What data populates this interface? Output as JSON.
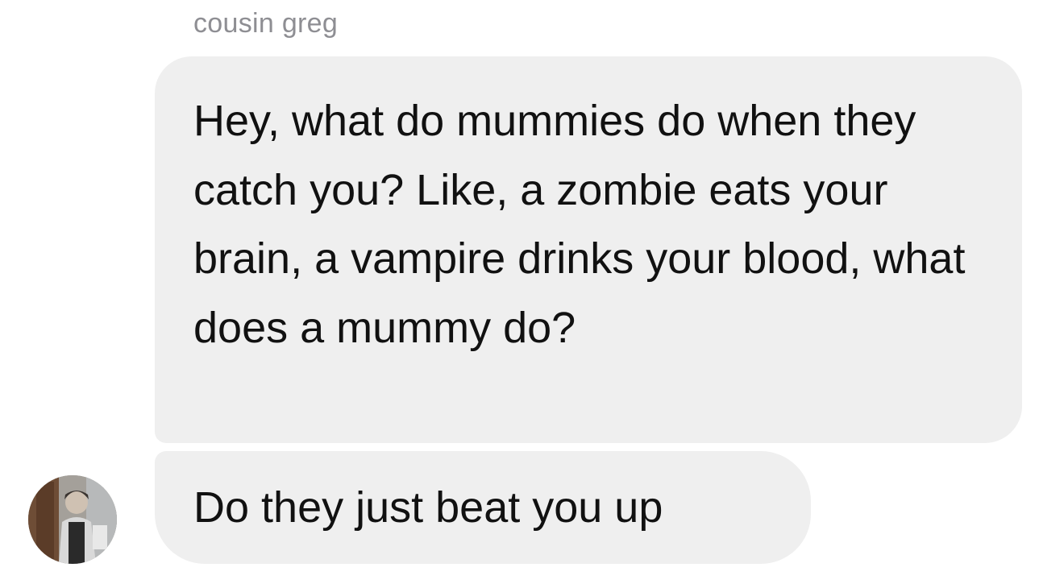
{
  "conversation": {
    "sender_name": "cousin greg",
    "messages": [
      {
        "text": "Hey, what do mummies do when they catch you? Like, a zombie eats your brain, a vampire drinks your blood, what does a mummy do?"
      },
      {
        "text": "Do they just beat you up"
      }
    ]
  },
  "colors": {
    "bubble_background": "#efefef",
    "sender_name_text": "#8e8e93",
    "message_text": "#111111"
  },
  "icons": {
    "avatar": "profile-photo"
  }
}
